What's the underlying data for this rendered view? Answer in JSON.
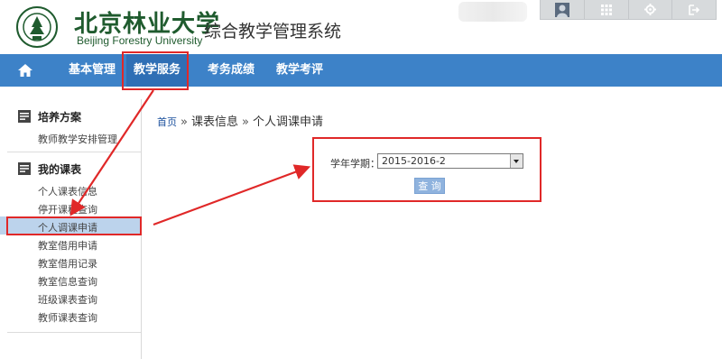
{
  "header": {
    "school_cn": "北京林业大学",
    "school_en": "Beijing Forestry University",
    "system_title": "综合教学管理系统",
    "icons": [
      "avatar-icon",
      "grid-icon",
      "gear-icon",
      "logout-icon"
    ]
  },
  "nav": {
    "home_icon": "home-icon",
    "items": [
      "基本管理",
      "教学服务",
      "考务成绩",
      "教学考评"
    ]
  },
  "sidebar": {
    "sections": [
      {
        "title": "培养方案",
        "icon": "list-icon",
        "links": [
          "教师教学安排管理"
        ]
      },
      {
        "title": "我的课表",
        "icon": "list-icon",
        "links": [
          "个人课表信息",
          "停开课程查询",
          "个人调课申请",
          "教室借用申请",
          "教室借用记录",
          "教室信息查询",
          "班级课表查询",
          "教师课表查询"
        ]
      }
    ],
    "active_link": "个人调课申请"
  },
  "breadcrumb": {
    "home": "首页",
    "sep": "»",
    "level1": "课表信息",
    "level2": "个人调课申请"
  },
  "form": {
    "term_label": "学年学期：",
    "term_value": "2015-2016-2",
    "query_label": "查 询"
  },
  "colors": {
    "nav": "#3d82c8",
    "nav_active": "#2f6fb5",
    "highlight": "#e02828",
    "sidebar_active": "#bcd3ec",
    "brand_green": "#1f5b2e"
  }
}
